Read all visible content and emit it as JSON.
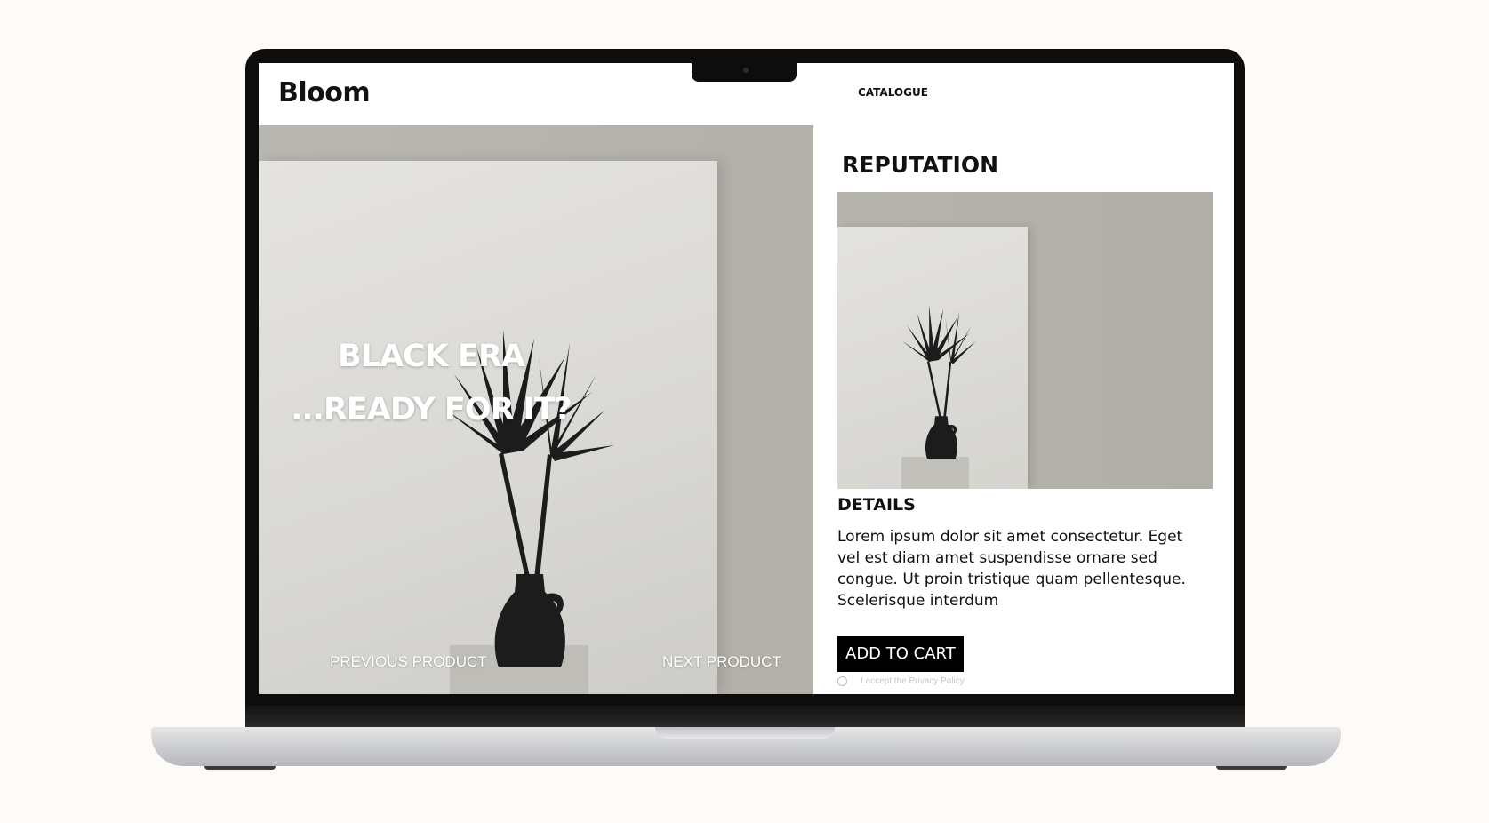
{
  "header": {
    "logo": "Bloom",
    "nav_catalogue": "CATALOGUE"
  },
  "hero": {
    "title_line1": "BLACK ERA",
    "title_line2": "...READY FOR IT?",
    "prev_label": "PREVIOUS PRODUCT",
    "next_label": "NEXT PRODUCT"
  },
  "product": {
    "section_title": "REPUTATION",
    "details_title": "DETAILS",
    "details_text": "Lorem ipsum dolor sit amet consectetur. Eget vel est diam amet suspendisse ornare sed congue. Ut proin tristique quam pellentesque. Scelerisque interdum",
    "add_to_cart": "ADD TO CART",
    "privacy_label": "I accept the Privacy Policy",
    "privacy_checked": false
  },
  "colors": {
    "page_bg": "#fdfaf8",
    "screen_bg": "#ffffff",
    "text": "#111111",
    "button_bg": "#000000",
    "button_text": "#ffffff",
    "photo_wall": "#b5b3ac",
    "vase": "#1a1a1a"
  },
  "icons": {
    "hero_image": "vase-with-dried-palm-photo",
    "product_image": "vase-with-dried-palm-photo",
    "privacy_checkbox": "radio-circle-icon"
  }
}
